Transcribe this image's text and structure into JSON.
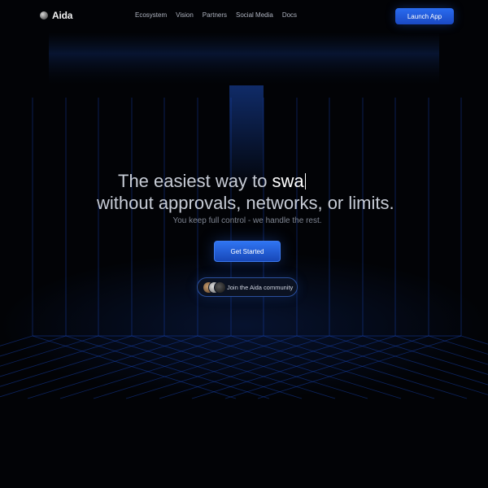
{
  "nav": {
    "logo_text": "Aida",
    "links": [
      "Ecosystem",
      "Vision",
      "Partners",
      "Social Media",
      "Docs"
    ],
    "launch_label": "Launch App"
  },
  "hero": {
    "line1_prefix": "The easiest way to ",
    "line1_typed": "swa",
    "line2": "without approvals, networks, or limits.",
    "subtitle": "You keep full control - we handle the rest.",
    "cta_label": "Get Started",
    "community_label": "Join the Aida community"
  },
  "colors": {
    "accent": "#2a6cf0",
    "background": "#020306",
    "grid_line": "#1d4fd8"
  },
  "icons": [
    "logo-mark-icon",
    "avatar-stack"
  ]
}
